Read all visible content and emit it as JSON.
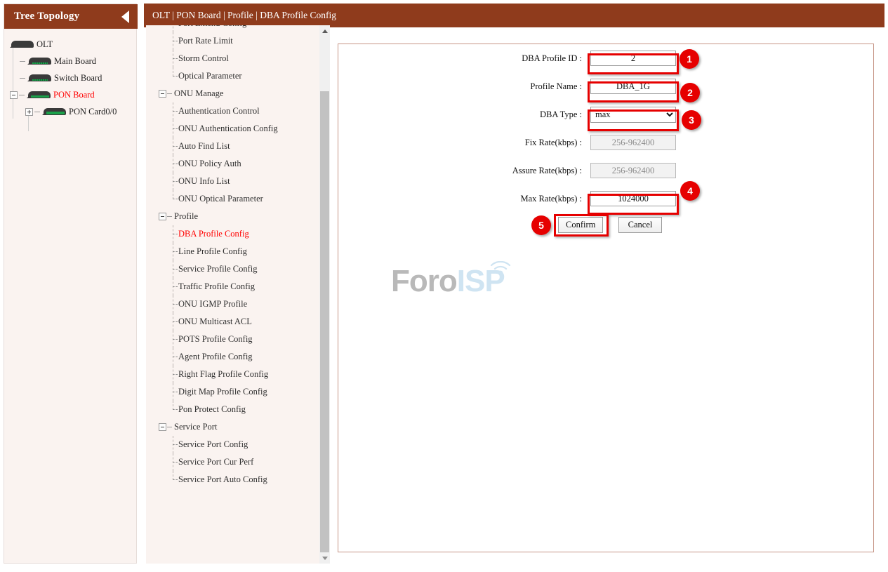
{
  "sidebar": {
    "title": "Tree Topology",
    "collapse_icon": "triangle-left-icon",
    "tree": [
      {
        "label": "OLT",
        "level": 0,
        "icon": "device-icon",
        "expander": null,
        "selected": false
      },
      {
        "label": "Main Board",
        "level": 1,
        "icon": "device-icon",
        "expander": "dash",
        "selected": false
      },
      {
        "label": "Switch Board",
        "level": 1,
        "icon": "device-icon",
        "expander": "dash",
        "selected": false
      },
      {
        "label": "PON Board",
        "level": 1,
        "icon": "device-icon",
        "expander": "minus",
        "selected": true
      },
      {
        "label": "PON Card0/0",
        "level": 2,
        "icon": "device-icon",
        "expander": "plus",
        "selected": false
      }
    ]
  },
  "topbar": {
    "breadcrumb": "OLT | PON Board | Profile | DBA Profile Config"
  },
  "menu": {
    "items": [
      {
        "label": "Port Extend Config",
        "type": "leaf",
        "selected": false
      },
      {
        "label": "Port Rate Limit",
        "type": "leaf",
        "selected": false
      },
      {
        "label": "Storm Control",
        "type": "leaf",
        "selected": false
      },
      {
        "label": "Optical Parameter",
        "type": "leaf",
        "selected": false,
        "last": true
      },
      {
        "label": "ONU Manage",
        "type": "group",
        "selected": false
      },
      {
        "label": "Authentication Control",
        "type": "leaf",
        "selected": false
      },
      {
        "label": "ONU Authentication Config",
        "type": "leaf",
        "selected": false
      },
      {
        "label": "Auto Find List",
        "type": "leaf",
        "selected": false
      },
      {
        "label": "ONU Policy Auth",
        "type": "leaf",
        "selected": false
      },
      {
        "label": "ONU Info List",
        "type": "leaf",
        "selected": false
      },
      {
        "label": "ONU Optical Parameter",
        "type": "leaf",
        "selected": false,
        "last": true
      },
      {
        "label": "Profile",
        "type": "group",
        "selected": false
      },
      {
        "label": "DBA Profile Config",
        "type": "leaf",
        "selected": true
      },
      {
        "label": "Line Profile Config",
        "type": "leaf",
        "selected": false
      },
      {
        "label": "Service Profile Config",
        "type": "leaf",
        "selected": false
      },
      {
        "label": "Traffic Profile Config",
        "type": "leaf",
        "selected": false
      },
      {
        "label": "ONU IGMP Profile",
        "type": "leaf",
        "selected": false
      },
      {
        "label": "ONU Multicast ACL",
        "type": "leaf",
        "selected": false
      },
      {
        "label": "POTS Profile Config",
        "type": "leaf",
        "selected": false
      },
      {
        "label": "Agent Profile Config",
        "type": "leaf",
        "selected": false
      },
      {
        "label": "Right Flag Profile Config",
        "type": "leaf",
        "selected": false
      },
      {
        "label": "Digit Map Profile Config",
        "type": "leaf",
        "selected": false
      },
      {
        "label": "Pon Protect Config",
        "type": "leaf",
        "selected": false,
        "last": true
      },
      {
        "label": "Service Port",
        "type": "group",
        "selected": false
      },
      {
        "label": "Service Port Config",
        "type": "leaf",
        "selected": false
      },
      {
        "label": "Service Port Cur Perf",
        "type": "leaf",
        "selected": false
      },
      {
        "label": "Service Port Auto Config",
        "type": "leaf",
        "selected": false,
        "last": true
      }
    ],
    "scrollbar": {
      "up_icon": "triangle-up-icon",
      "down_icon": "triangle-down-icon"
    }
  },
  "form": {
    "fields": [
      {
        "label": "DBA Profile ID :",
        "value": "2",
        "placeholder": "",
        "disabled": false,
        "kind": "text"
      },
      {
        "label": "Profile Name :",
        "value": "DBA_1G",
        "placeholder": "",
        "disabled": false,
        "kind": "text"
      },
      {
        "label": "DBA Type :",
        "value": "max",
        "placeholder": "",
        "disabled": false,
        "kind": "select"
      },
      {
        "label": "Fix Rate(kbps) :",
        "value": "",
        "placeholder": "256-962400",
        "disabled": true,
        "kind": "text"
      },
      {
        "label": "Assure Rate(kbps) :",
        "value": "",
        "placeholder": "256-962400",
        "disabled": true,
        "kind": "text"
      },
      {
        "label": "Max Rate(kbps) :",
        "value": "1024000",
        "placeholder": "",
        "disabled": false,
        "kind": "text"
      }
    ],
    "dba_type_options": [
      "max"
    ],
    "confirm_label": "Confirm",
    "cancel_label": "Cancel"
  },
  "annotations": {
    "badges": [
      "1",
      "2",
      "3",
      "4",
      "5"
    ],
    "highlight_color": "#e60000",
    "badge_color": "#e60000"
  },
  "watermark": {
    "text_primary": "Foro",
    "text_secondary": "ISP",
    "color_primary": "#b9b9b9",
    "color_secondary": "#cfe4f2"
  },
  "theme": {
    "header_bar": "#8f3b1c",
    "panel_bg": "#faf3f0",
    "content_border": "#c69586",
    "selected_text": "#ff0000"
  }
}
